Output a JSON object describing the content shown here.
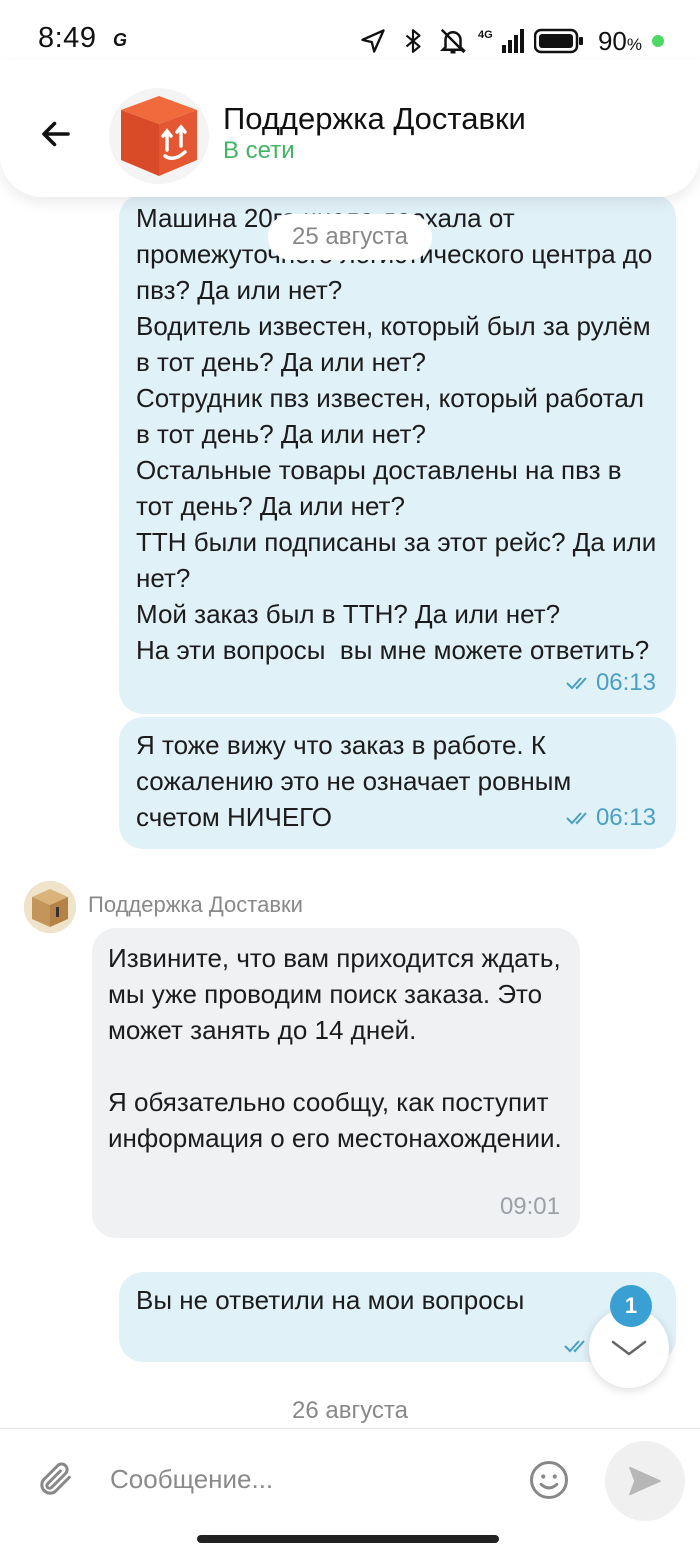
{
  "status_bar": {
    "time": "8:49",
    "app_icon_glyph": "G",
    "network": "4G",
    "battery": "90",
    "battery_unit": "%"
  },
  "header": {
    "title": "Поддержка Доставки",
    "status": "В сети",
    "status_color": "#41b563"
  },
  "chat": {
    "date_top": "25 августа",
    "date_bottom": "26 августа",
    "messages": [
      {
        "direction": "out",
        "text": "Машина 20го числа доехала от промежуточного логистического центра до пвз? Да или нет?\nВодитель известен, который был за рулём в тот день? Да или нет?\nСотрудник пвз известен, который работал в тот день? Да или нет?\nОстальные товары доставлены на пвз в тот день? Да или нет?\nТТН были подписаны за этот рейс? Да или нет?\nМой заказ был в ТТН? Да или нет?\nНа эти вопросы  вы мне можете ответить?",
        "time": "06:13"
      },
      {
        "direction": "out",
        "text": "Я тоже вижу что заказ в работе. К сожалению это не означает ровным счетом НИЧЕГО",
        "time": "06:13"
      },
      {
        "direction": "in",
        "sender": "Поддержка Доставки",
        "text": "Извините, что вам приходится ждать, мы уже проводим поиск заказа. Это может занять до 14 дней.\n\nЯ обязательно сообщу, как поступит информация о его местонахождении.",
        "time": "09:01"
      },
      {
        "direction": "out",
        "text": "Вы не ответили на мои вопросы",
        "time": ""
      }
    ]
  },
  "scroll_fab": {
    "badge": "1"
  },
  "composer": {
    "placeholder": "Сообщение..."
  },
  "colors": {
    "bubble_out": "#e0f1f7",
    "bubble_in": "#f0f1f3",
    "accent": "#3aa0d3"
  }
}
